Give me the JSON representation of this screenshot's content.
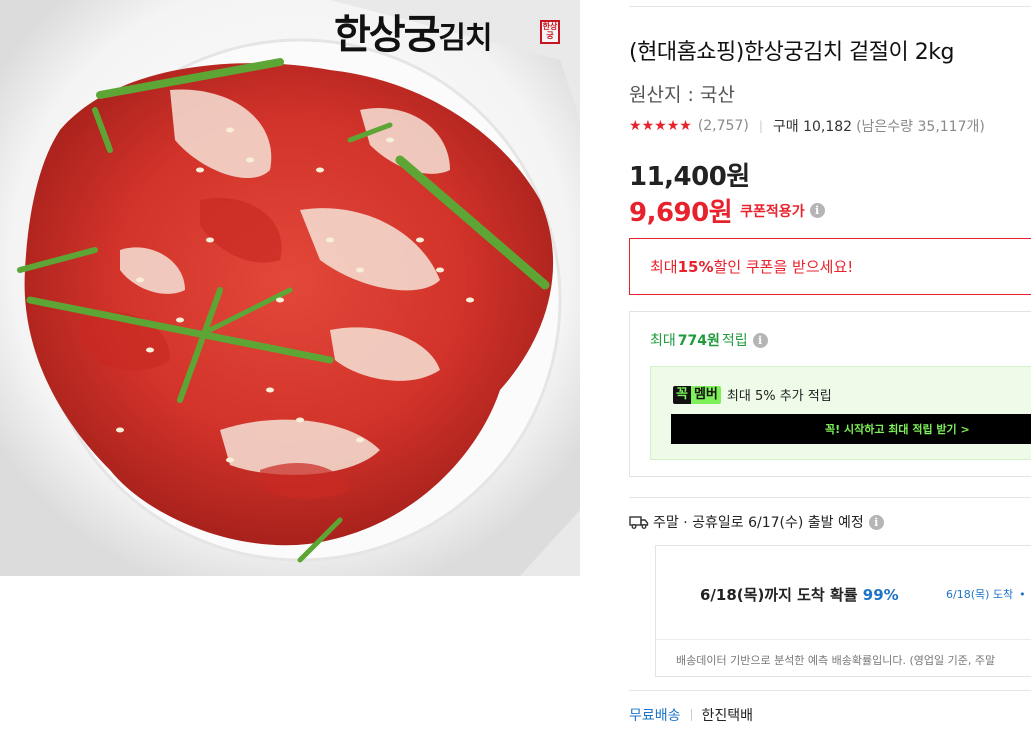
{
  "image": {
    "brand_big": "한상궁",
    "brand_small": "김치",
    "seal": "한상궁"
  },
  "product": {
    "title": "(현대홈쇼핑)한상궁김치 겉절이 2kg",
    "origin": "원산지 : 국산",
    "rating_stars": 5,
    "review_count": "(2,757)",
    "purchase": "구매 10,182",
    "remaining": "(남은수량 35,117개)",
    "original_price": "11,400원",
    "sale_price": "9,690원",
    "coupon_applied_label": "쿠폰적용가"
  },
  "coupon_banner": {
    "prefix": "최대 ",
    "highlight": "15%",
    "suffix": " 할인 쿠폰을 받으세요!"
  },
  "points": {
    "prefix": "최대",
    "amount": "774원",
    "suffix": "적립"
  },
  "member": {
    "badge_k": "꼭",
    "badge_m": "멤버",
    "text": "최대 5% 추가 적립",
    "cta": "꼭! 시작하고 최대 적립 받기 >"
  },
  "shipping": {
    "notice": "주말 · 공휴일로 6/17(수) 출발 예정",
    "arrival_text": "6/18(목)까지 도착 확률 ",
    "arrival_pct": "99%",
    "arrival_side": "6/18(목) 도착",
    "note": "배송데이터 기반으로 분석한 예측 배송확률입니다. (영업일 기준, 주말"
  },
  "delivery": {
    "free": "무료배송",
    "courier": "한진택배"
  },
  "colors": {
    "accent_red": "#e8222d",
    "points_green": "#1e9b3c",
    "link_blue": "#1d74c8",
    "member_green": "#7ef05a"
  }
}
